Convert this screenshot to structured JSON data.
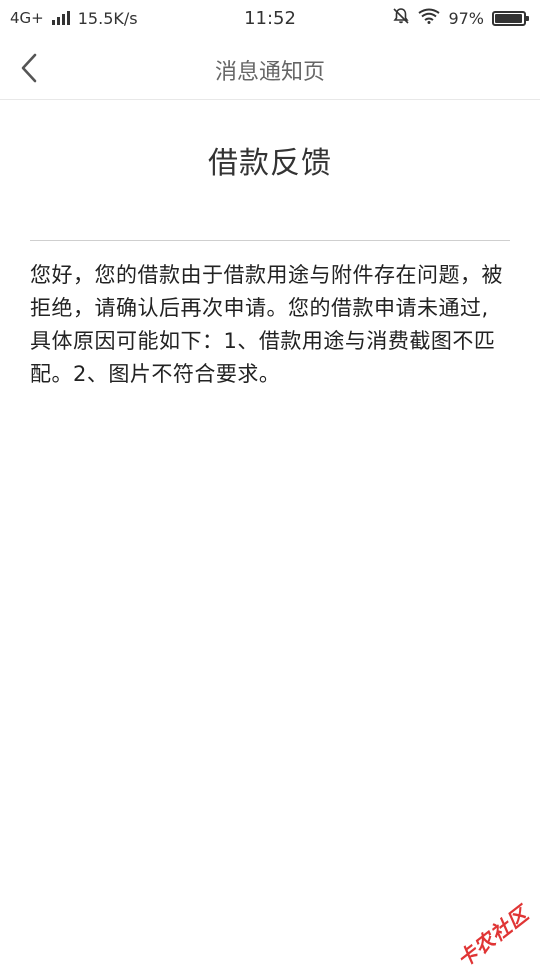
{
  "status_bar": {
    "network": "4G+",
    "speed": "15.5K/s",
    "time": "11:52",
    "battery": "97%",
    "battery_level": 0.97
  },
  "nav": {
    "title": "消息通知页"
  },
  "article": {
    "title": "借款反馈",
    "body": "您好，您的借款由于借款用途与附件存在问题，被拒绝，请确认后再次申请。您的借款申请未通过,具体原因可能如下：1、借款用途与消费截图不匹配。2、图片不符合要求。"
  },
  "watermark": {
    "text": "卡农社区"
  },
  "icons": {
    "back": "chevron-left-icon",
    "signal": "signal-bars-icon",
    "mute": "bell-off-icon",
    "wifi": "wifi-icon",
    "battery": "battery-icon"
  }
}
